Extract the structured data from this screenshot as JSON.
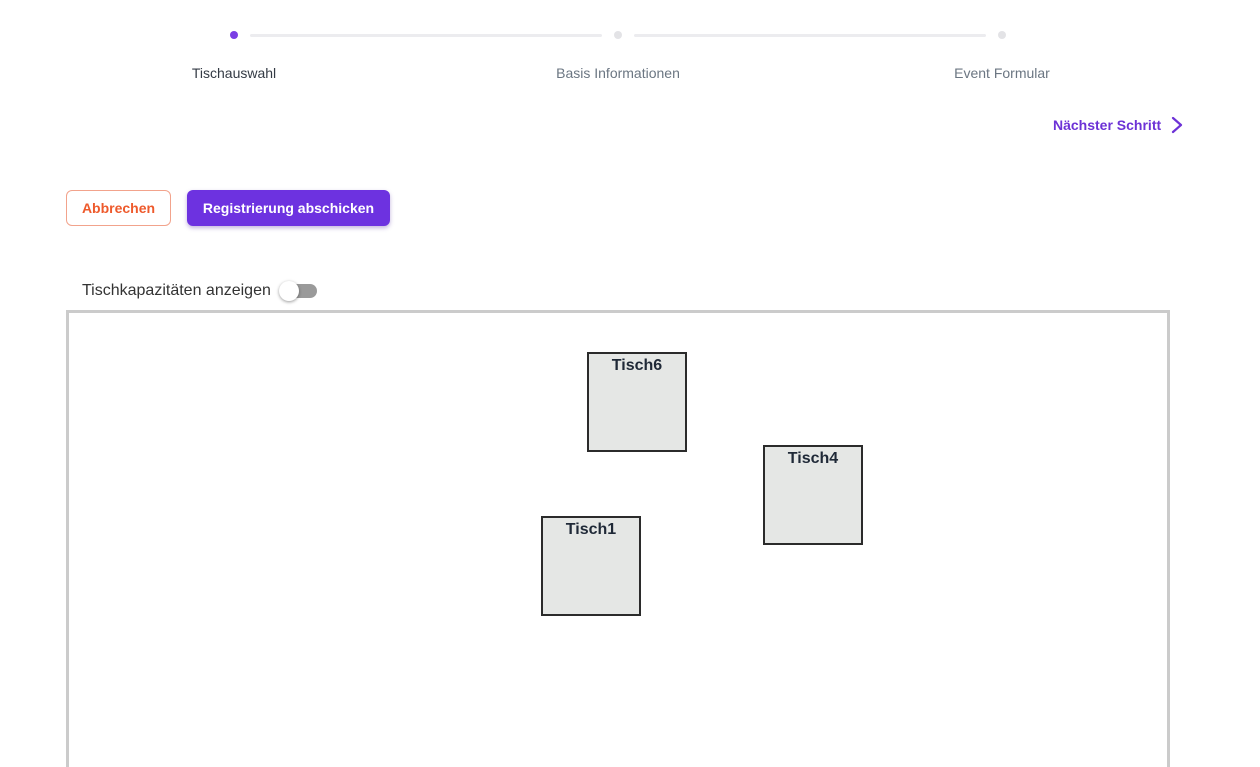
{
  "stepper": {
    "steps": [
      {
        "label": "Tischauswahl",
        "state": "active"
      },
      {
        "label": "Basis Informationen",
        "state": "inactive"
      },
      {
        "label": "Event Formular",
        "state": "inactive"
      }
    ]
  },
  "navigation": {
    "next_step_label": "Nächster Schritt",
    "next_step_icon": "chevron-right-icon"
  },
  "actions": {
    "cancel_label": "Abbrechen",
    "submit_label": "Registrierung abschicken"
  },
  "capacity_toggle": {
    "label": "Tischkapazitäten anzeigen",
    "checked": false
  },
  "floor_plan": {
    "tables": [
      {
        "name": "Tisch6"
      },
      {
        "name": "Tisch4"
      },
      {
        "name": "Tisch1"
      }
    ]
  },
  "colors": {
    "accent": "#6d32e0",
    "cancel": "#ee5a2c",
    "table_fill": "#e5e7e5"
  }
}
